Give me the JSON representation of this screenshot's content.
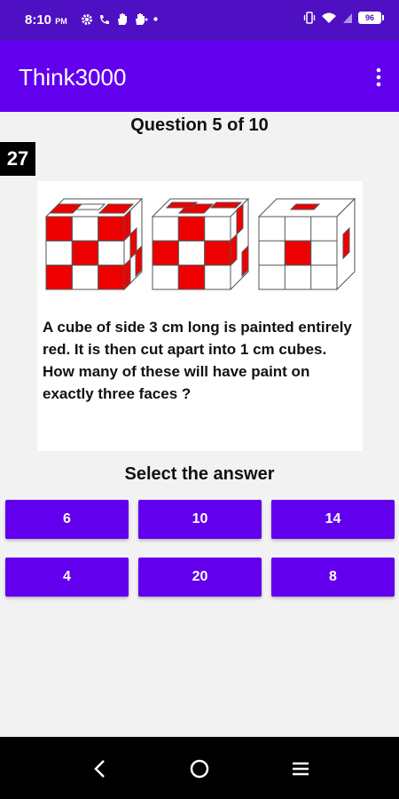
{
  "status_bar": {
    "time": "8:10",
    "ampm": "PM",
    "battery": "96",
    "icons_left": [
      "gear-icon",
      "missed-call-icon",
      "hand-icon",
      "hand-icon",
      "dot-icon"
    ],
    "icons_right": [
      "vibrate-icon",
      "wifi-icon",
      "signal-icon",
      "battery-icon"
    ]
  },
  "app_bar": {
    "title": "Think3000",
    "menu_icon": "overflow-menu-icon"
  },
  "quiz": {
    "question_header": "Question 5 of 10",
    "timer": "27",
    "question_text": "A cube of side 3 cm long is painted entirely red. It is then cut apart into 1 cm cubes. How many of these will have paint on exactly  three faces ?",
    "select_label": "Select the answer",
    "answers": [
      "6",
      "10",
      "14",
      "4",
      "20",
      "8"
    ]
  },
  "nav_bar": {
    "buttons": [
      "back-icon",
      "home-icon",
      "recents-icon"
    ]
  },
  "colors": {
    "status_bar": "#4f10c4",
    "app_bar": "#6200ee",
    "button": "#6200ee",
    "cube_red": "#ee0000"
  }
}
